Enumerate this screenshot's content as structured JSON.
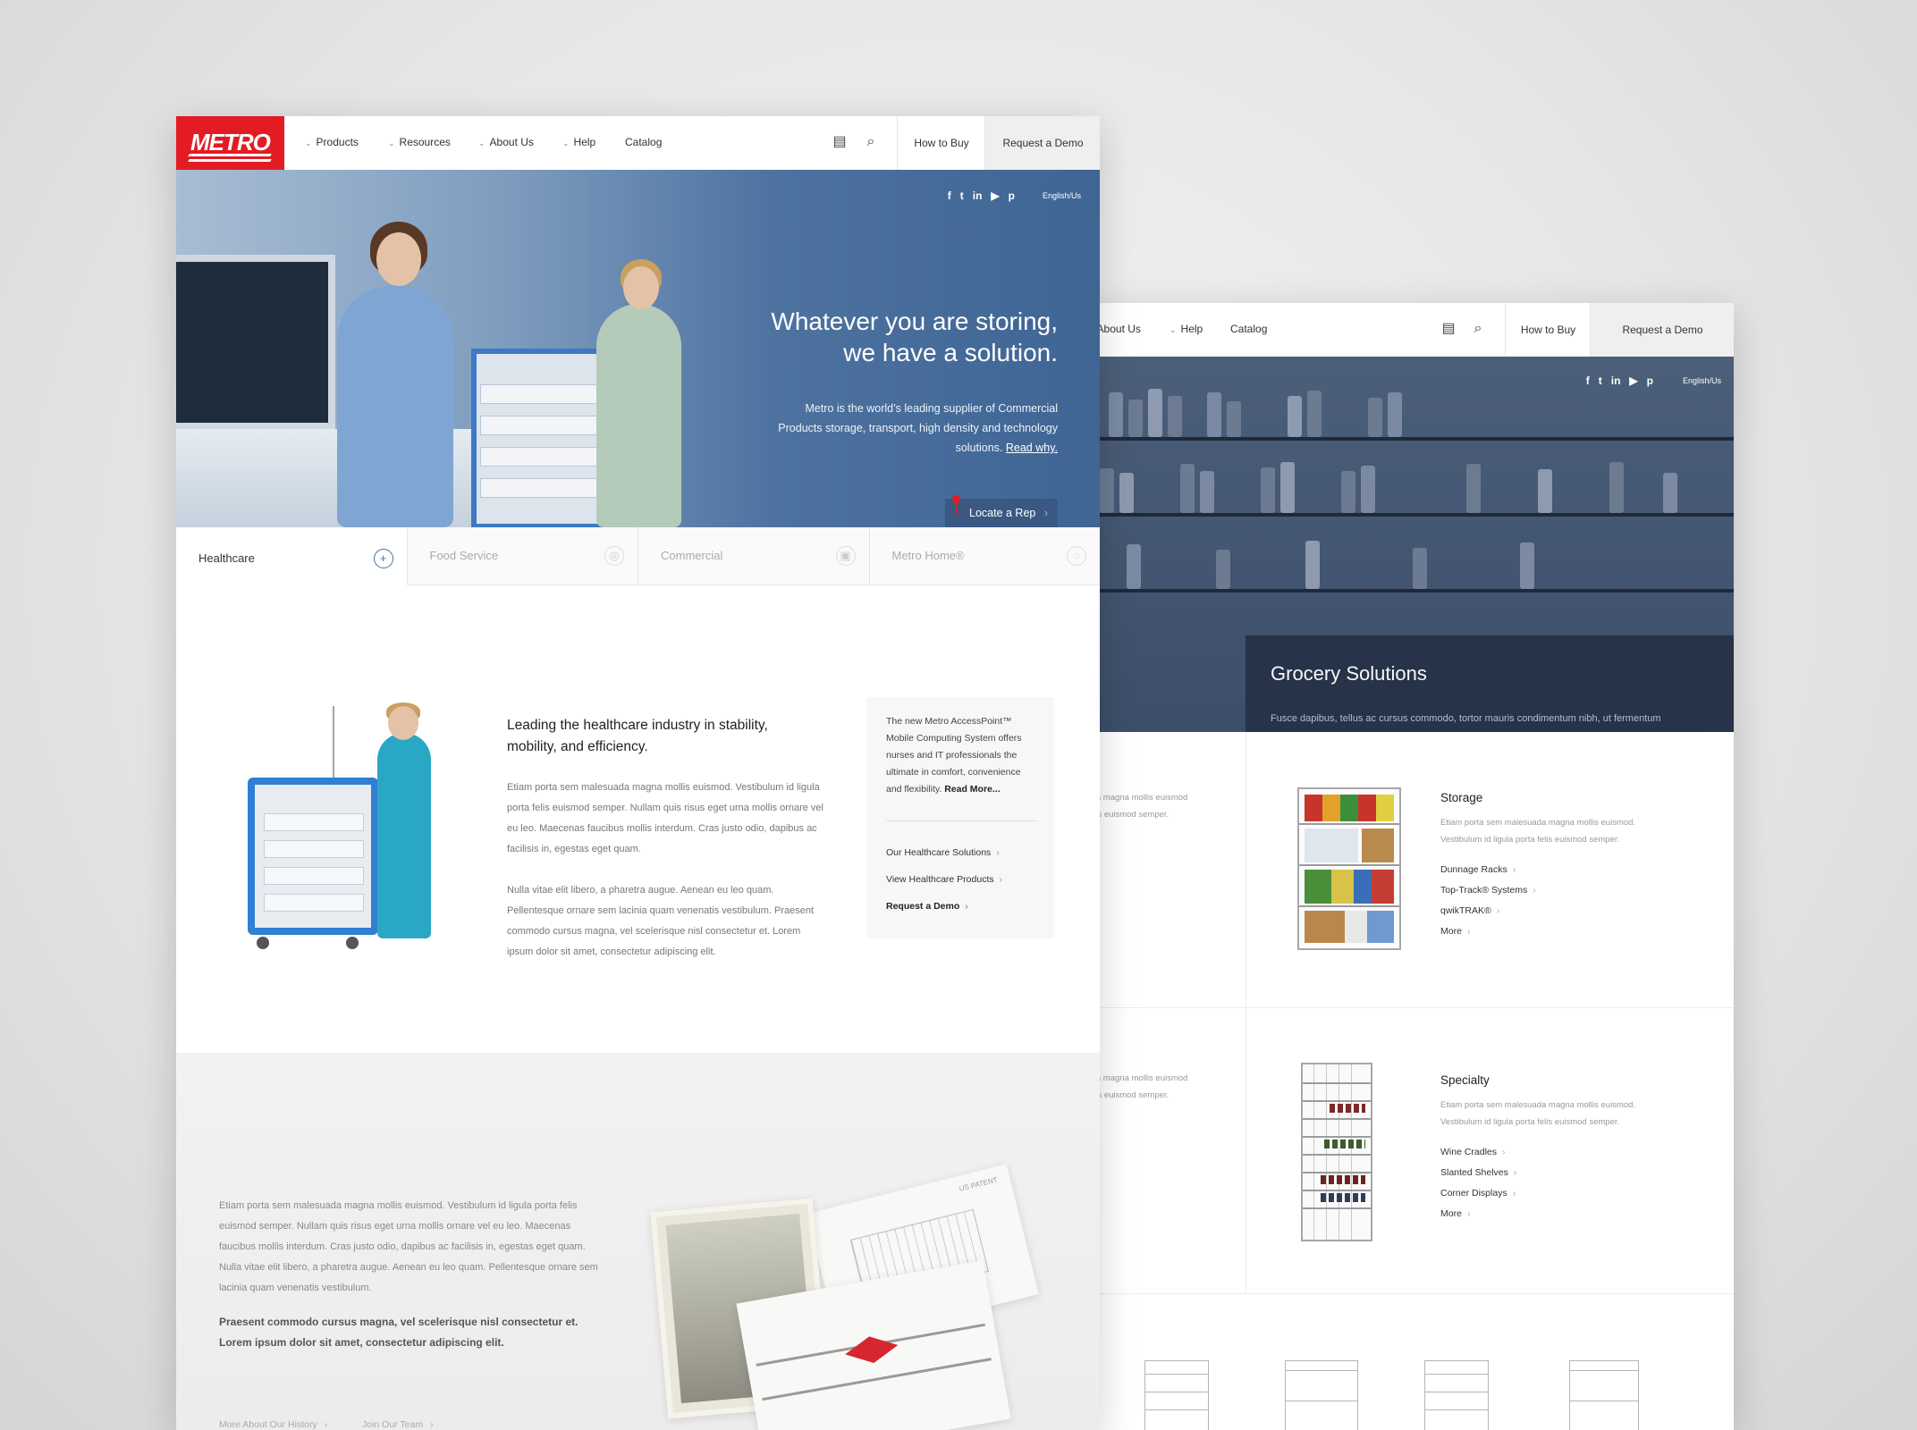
{
  "colors": {
    "brand": "#e31b23",
    "hero": "#3f6594",
    "accent": "#4b6f9e"
  },
  "front": {
    "logo": "METRO",
    "nav": {
      "menu": [
        "Products",
        "Resources",
        "About Us",
        "Help",
        "Catalog"
      ],
      "icons": [
        "chat-icon",
        "search-icon"
      ],
      "how_to_buy": "How to Buy",
      "request_demo": "Request a Demo"
    },
    "hero": {
      "social": [
        "f",
        "t",
        "in",
        "yt",
        "p"
      ],
      "lang": "English/Us",
      "title_line1": "Whatever you are storing,",
      "title_line2": "we have a solution.",
      "text": "Metro is the world’s leading supplier of Commercial Products storage, transport, high density and technology solutions.",
      "read_why": "Read why.",
      "locate": "Locate a Rep"
    },
    "tabs": [
      {
        "label": "Healthcare",
        "icon": "plus-icon",
        "active": true
      },
      {
        "label": "Food Service",
        "icon": "circle-icon",
        "active": false
      },
      {
        "label": "Commercial",
        "icon": "circle-icon",
        "active": false
      },
      {
        "label": "Metro Home®",
        "icon": "circle-icon",
        "active": false
      }
    ],
    "healthcare": {
      "title": "Leading the healthcare industry in stability, mobility, and efficiency.",
      "p1": "Etiam porta sem malesuada magna mollis euismod. Vestibulum id ligula porta felis euismod semper. Nullam quis risus eget urna mollis ornare vel eu leo. Maecenas faucibus mollis interdum. Cras justo odio, dapibus ac facilisis in, egestas eget quam.",
      "p2": "Nulla vitae elit libero, a pharetra augue. Aenean eu leo quam. Pellentesque ornare sem lacinia quam venenatis vestibulum. Praesent commodo cursus magna, vel scelerisque nisl consectetur et. Lorem ipsum dolor sit amet, consectetur adipiscing elit.",
      "side_text": "The new Metro AccessPoint™ Mobile Computing System offers nurses and IT professionals the ultimate in comfort, convenience and flexibility.",
      "side_read_more": "Read More...",
      "links": [
        "Our Healthcare Solutions",
        "View Healthcare Products",
        "Request a Demo"
      ]
    },
    "history": {
      "p": "Etiam porta sem malesuada magna mollis euismod. Vestibulum id ligula porta felis euismod semper. Nullam quis risus eget urna mollis ornare vel eu leo. Maecenas faucibus mollis interdum. Cras justo odio, dapibus ac facilisis in, egestas eget quam. Nulla vitae elit libero, a pharetra augue. Aenean eu leo quam. Pellentesque ornare sem lacinia quam venenatis vestibulum.",
      "bold": "Praesent commodo cursus magna, vel scelerisque nisl consectetur et. Lorem ipsum dolor sit amet, consectetur adipiscing elit.",
      "links": [
        "More About Our History",
        "Join Our Team"
      ],
      "patent": "US PATENT"
    }
  },
  "back": {
    "nav": {
      "menu": [
        "About Us",
        "Help",
        "Catalog"
      ],
      "how_to_buy": "How to Buy",
      "request_demo": "Request a Demo"
    },
    "hero": {
      "lang": "English/Us",
      "title": "Grocery Solutions",
      "text": "Fusce dapibus, tellus ac cursus commodo, tortor mauris condimentum nibh, ut fermentum massa justo sit amet risus. Cras justo odio, dapibus ac facilisis."
    },
    "partial_text": [
      "esuada magna mollis euismod",
      "sta felis euismod semper."
    ],
    "storage": {
      "title": "Storage",
      "p": "Etiam porta sem malesuada magna mollis euismod. Vestibulum id ligula porta felis euismod semper.",
      "links": [
        "Dunnage Racks",
        "Top-Track® Systems",
        "qwikTRAK®",
        "More"
      ]
    },
    "specialty": {
      "title": "Specialty",
      "p": "Etiam porta sem malesuada magna mollis euismod. Vestibulum id ligula porta felis euismod semper.",
      "links": [
        "Wine Cradles",
        "Slanted Shelves",
        "Corner Displays",
        "More"
      ]
    }
  }
}
